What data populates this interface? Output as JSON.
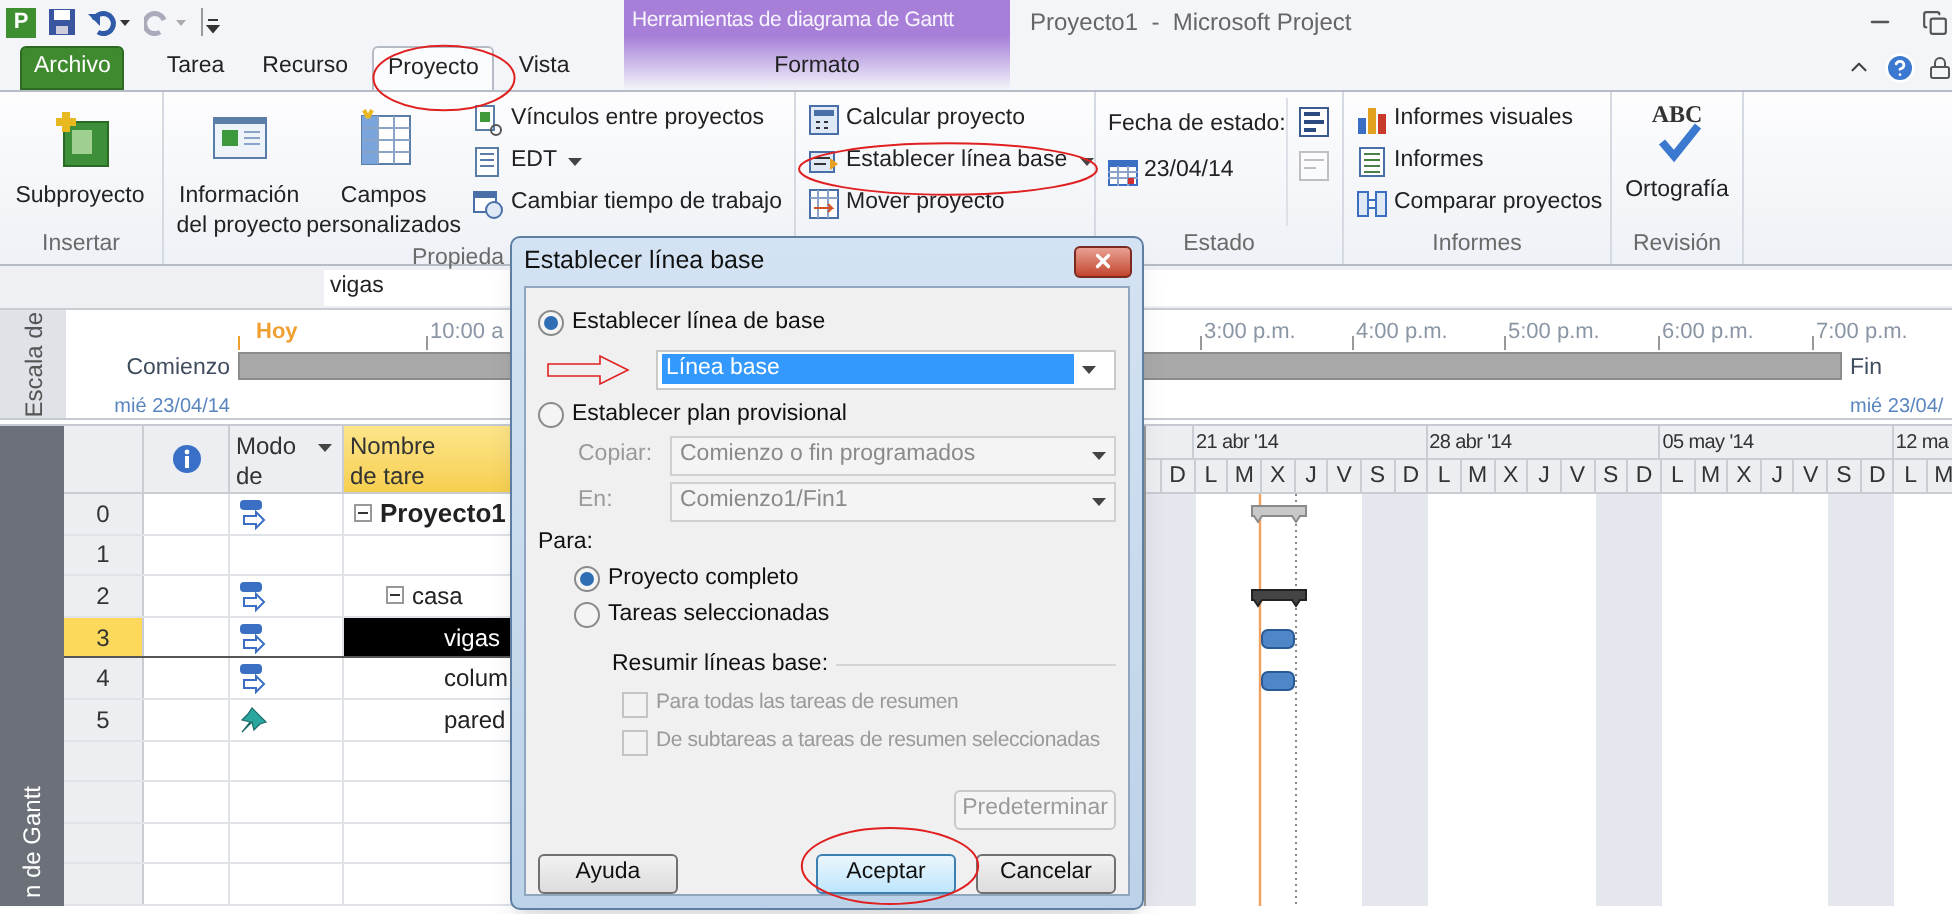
{
  "app_logo": "P",
  "contextual_tab_group": {
    "label": "Herramientas de diagrama de Gantt"
  },
  "window": {
    "title": "Proyecto1  -  Microsoft Project"
  },
  "tabs": [
    {
      "label": "Archivo",
      "kind": "file",
      "selected": false
    },
    {
      "label": "Tarea",
      "kind": "normal",
      "selected": false
    },
    {
      "label": "Recurso",
      "kind": "normal",
      "selected": false
    },
    {
      "label": "Proyecto",
      "kind": "normal",
      "selected": true
    },
    {
      "label": "Vista",
      "kind": "normal",
      "selected": false
    },
    {
      "label": "Formato",
      "kind": "contextual",
      "selected": false
    }
  ],
  "ribbon": {
    "groups": [
      {
        "label": "Insertar",
        "items": [
          {
            "label": "Subproyecto"
          }
        ]
      },
      {
        "label": "Propieda",
        "items": [
          {
            "label": "Información del proyecto"
          },
          {
            "label": "Campos personalizados"
          },
          {
            "label": "Vínculos entre proyectos",
            "dropdown": false
          },
          {
            "label": "EDT",
            "dropdown": true
          },
          {
            "label": "Cambiar tiempo de trabajo",
            "dropdown": false
          }
        ]
      },
      {
        "items": [
          {
            "label": "Calcular proyecto",
            "dropdown": false
          },
          {
            "label": "Establecer línea base",
            "dropdown": true
          },
          {
            "label": "Mover proyecto",
            "dropdown": false
          }
        ]
      },
      {
        "label": "Estado",
        "status_date_label": "Fecha de estado:",
        "status_date": "23/04/14"
      },
      {
        "label": "Informes",
        "items": [
          {
            "label": "Informes visuales",
            "dropdown": false
          },
          {
            "label": "Informes",
            "dropdown": false
          },
          {
            "label": "Comparar proyectos",
            "dropdown": false
          }
        ]
      },
      {
        "label": "Revisión",
        "items": [
          {
            "label": "Ortografía",
            "icon_text": "ABC"
          }
        ]
      }
    ]
  },
  "entry_bar": {
    "value": "vigas"
  },
  "timeline": {
    "side_label": "Escala de",
    "start": {
      "label": "Comienzo",
      "date": "mié 23/04/14"
    },
    "end": {
      "label": "Fin",
      "date": "mié 23/04/"
    },
    "ticks": [
      {
        "label": "Hoy",
        "kind": "today"
      },
      {
        "label": "10:00 a",
        "kind": "time"
      },
      {
        "label": "3:00 p.m.",
        "kind": "time"
      },
      {
        "label": "4:00 p.m.",
        "kind": "time"
      },
      {
        "label": "5:00 p.m.",
        "kind": "time"
      },
      {
        "label": "6:00 p.m.",
        "kind": "time"
      },
      {
        "label": "7:00 p.m.",
        "kind": "time"
      }
    ]
  },
  "grid": {
    "side_label": "n de Gantt",
    "columns": [
      {
        "kind": "info"
      },
      {
        "kind": "text",
        "label": "Modo de"
      },
      {
        "kind": "text",
        "label": "Nombre de tare",
        "highlighted": true
      }
    ],
    "rows": [
      {
        "id": "0",
        "name": "Proyecto1",
        "kind": "auto",
        "expanded": true,
        "selected": false,
        "children": [
          {
            "id": "1",
            "kind": "empty",
            "selected": false
          },
          {
            "id": "2",
            "name": "casa",
            "kind": "auto",
            "expanded": true,
            "selected": false,
            "children": [
              {
                "id": "3",
                "name": "vigas",
                "kind": "auto",
                "selected": true
              },
              {
                "id": "4",
                "name": "colum",
                "kind": "auto",
                "selected": false
              },
              {
                "id": "5",
                "name": "pared",
                "kind": "manual",
                "selected": false
              }
            ]
          }
        ]
      }
    ]
  },
  "gantt": {
    "weeks": [
      "21 abr '14",
      "28 abr '14",
      "05 may '14",
      "12 ma"
    ],
    "days": [
      {
        "label": "D",
        "weekend": true
      },
      {
        "label": "L",
        "weekend": false
      },
      {
        "label": "M",
        "weekend": false
      },
      {
        "label": "X",
        "weekend": false
      },
      {
        "label": "J",
        "weekend": false
      },
      {
        "label": "V",
        "weekend": false
      },
      {
        "label": "S",
        "weekend": true
      },
      {
        "label": "D",
        "weekend": true
      },
      {
        "label": "L",
        "weekend": false
      },
      {
        "label": "M",
        "weekend": false
      },
      {
        "label": "X",
        "weekend": false
      },
      {
        "label": "J",
        "weekend": false
      },
      {
        "label": "V",
        "weekend": false
      },
      {
        "label": "S",
        "weekend": true
      },
      {
        "label": "D",
        "weekend": true
      },
      {
        "label": "L",
        "weekend": false
      },
      {
        "label": "M",
        "weekend": false
      },
      {
        "label": "X",
        "weekend": false
      },
      {
        "label": "J",
        "weekend": false
      },
      {
        "label": "V",
        "weekend": false
      },
      {
        "label": "S",
        "weekend": true
      },
      {
        "label": "D",
        "weekend": true
      },
      {
        "label": "L",
        "weekend": false
      },
      {
        "label": "M",
        "weekend": false
      }
    ]
  },
  "dialog": {
    "title": "Establecer línea base",
    "options": [
      {
        "label": "Establecer línea de base",
        "selected": true
      },
      {
        "label": "Establecer plan provisional",
        "selected": false
      }
    ],
    "baseline_dropdown": {
      "value": "Línea base"
    },
    "copy": {
      "label": "Copiar:",
      "value": "Comienzo o fin programados",
      "disabled": true
    },
    "into": {
      "label": "En:",
      "value": "Comienzo1/Fin1",
      "disabled": true
    },
    "for_label": "Para:",
    "scope": [
      {
        "label": "Proyecto completo",
        "selected": true
      },
      {
        "label": "Tareas seleccionadas",
        "selected": false
      }
    ],
    "rollup_label": "Resumir líneas base:",
    "rollup_options": [
      {
        "label": "Para todas las tareas de resumen",
        "checked": false,
        "disabled": true
      },
      {
        "label": "De subtareas a tareas de resumen seleccionadas",
        "checked": false,
        "disabled": true
      }
    ],
    "set_default_button": {
      "label": "Predeterminar",
      "disabled": true
    },
    "buttons": [
      {
        "label": "Ayuda",
        "default": false
      },
      {
        "label": "Aceptar",
        "default": true
      },
      {
        "label": "Cancelar",
        "default": false
      }
    ]
  }
}
